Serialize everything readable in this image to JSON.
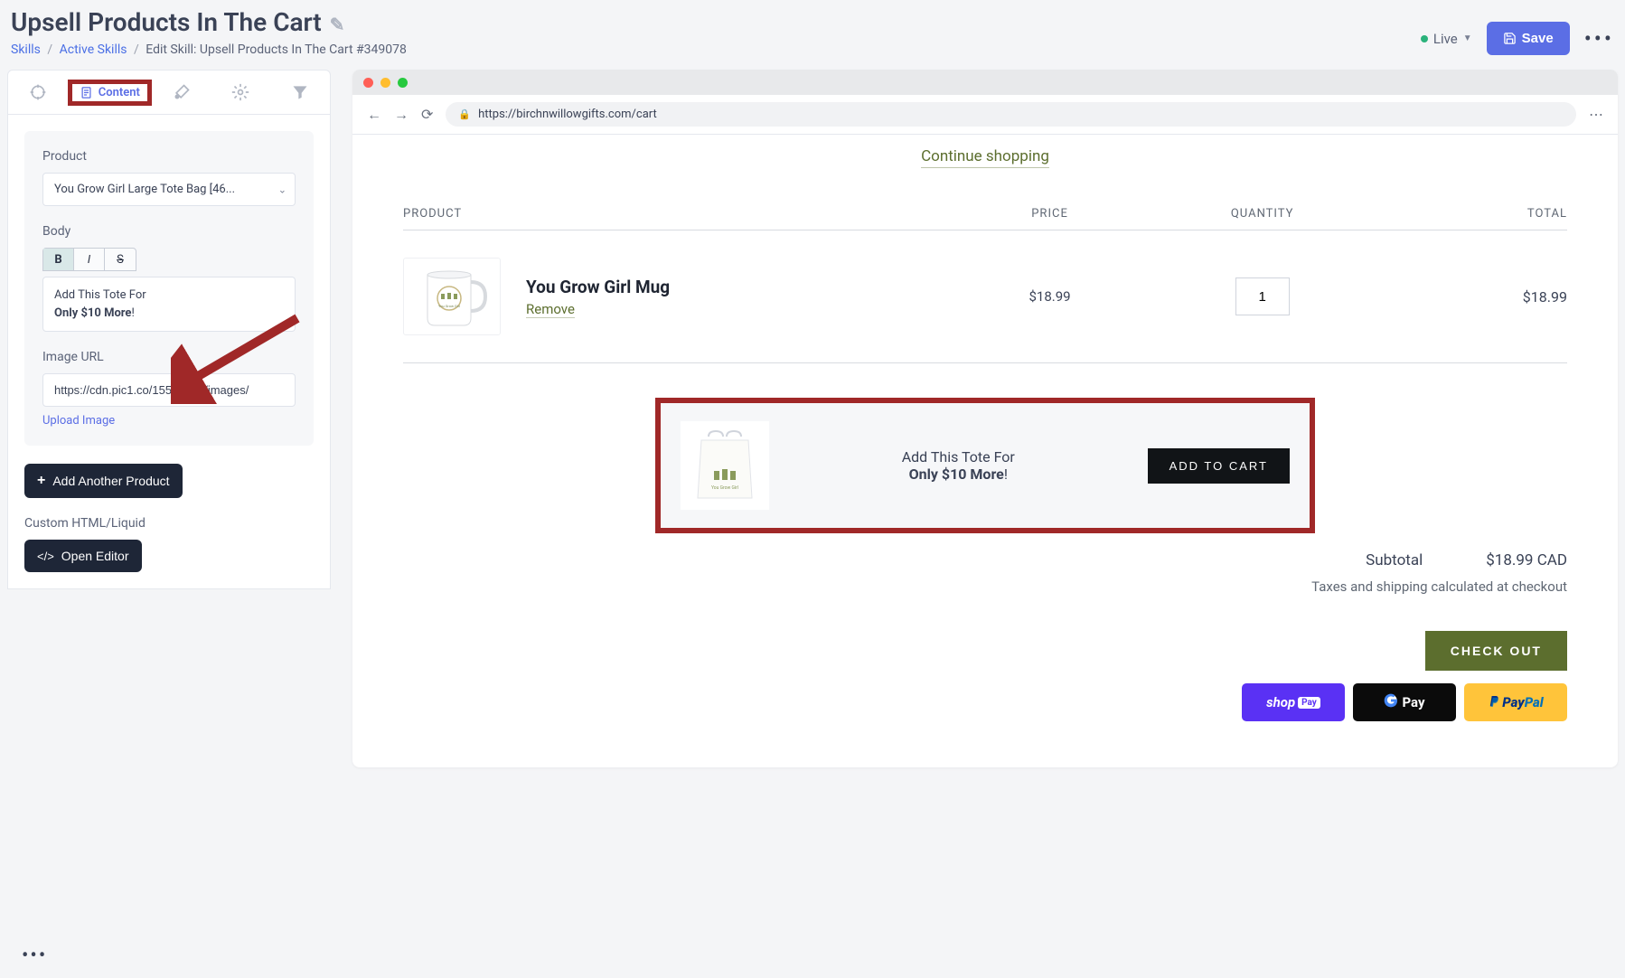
{
  "header": {
    "title": "Upsell Products In The Cart",
    "breadcrumb": {
      "skills": "Skills",
      "active_skills": "Active Skills",
      "current": "Edit Skill: Upsell Products In The Cart #349078"
    },
    "status": "Live",
    "save": "Save"
  },
  "sidebar": {
    "tabs": {
      "content": "Content"
    },
    "product_label": "Product",
    "product_value": "You Grow Girl Large Tote Bag [46...",
    "body_label": "Body",
    "body_line1": "Add This Tote For",
    "body_line2_strong": "Only $10 More",
    "body_line2_tail": "!",
    "image_url_label": "Image URL",
    "image_url_value": "https://cdn.pic1.co/15547567/images/",
    "upload_image": "Upload Image",
    "add_another": "Add Another Product",
    "custom_html_label": "Custom HTML/Liquid",
    "open_editor": "Open Editor"
  },
  "browser": {
    "url": "https://birchnwillowgifts.com/cart"
  },
  "cart": {
    "continue_shopping": "Continue shopping",
    "headers": {
      "product": "PRODUCT",
      "price": "PRICE",
      "quantity": "QUANTITY",
      "total": "TOTAL"
    },
    "item": {
      "name": "You Grow Girl Mug",
      "remove": "Remove",
      "price": "$18.99",
      "qty": "1",
      "total": "$18.99"
    },
    "upsell": {
      "line1": "Add This Tote For",
      "line2": "Only $10 More",
      "line2_tail": "!",
      "button": "ADD TO CART"
    },
    "subtotal_label": "Subtotal",
    "subtotal_value": "$18.99 CAD",
    "tax_note": "Taxes and shipping calculated at checkout",
    "checkout": "CHECK OUT",
    "pay": {
      "shop": "shop",
      "shop_pay": "Pay",
      "gpay": "Pay",
      "paypal1": "Pay",
      "paypal2": "Pal"
    }
  }
}
